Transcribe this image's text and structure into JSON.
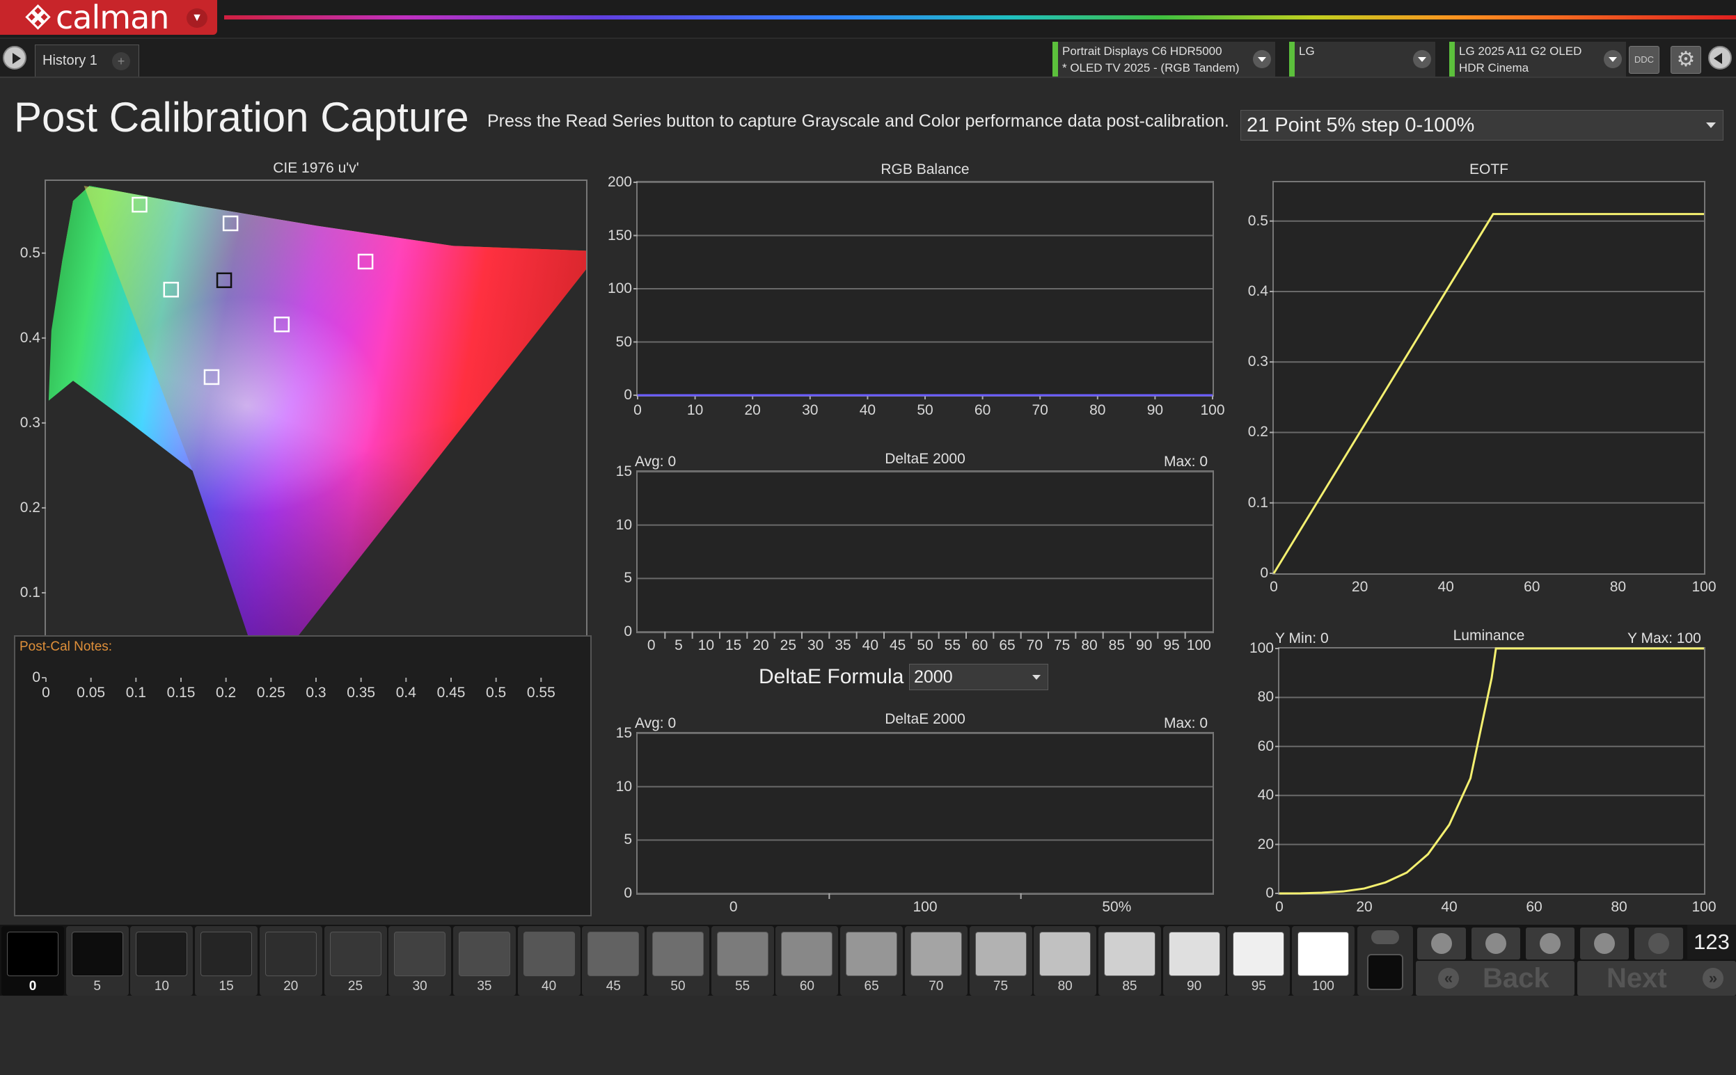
{
  "app": {
    "name": "calman",
    "tab": "History 1",
    "plus": "+"
  },
  "devices": [
    {
      "line1": "Portrait Displays C6 HDR5000",
      "line2": "* OLED TV 2025 - (RGB Tandem)",
      "status_color": "#5cc03c"
    },
    {
      "line1": "LG",
      "line2": "",
      "status_color": "#5cc03c"
    },
    {
      "line1": "LG 2025 A11 G2 OLED",
      "line2": "HDR Cinema",
      "status_color": "#5cc03c"
    }
  ],
  "toolbar": {
    "ddc": "DDC",
    "settings_icon": "gear-icon",
    "collapse_icon": "chevron-left-icon"
  },
  "page": {
    "title": "Post Calibration Capture",
    "instructions": "Press the Read Series button to capture Grayscale and Color performance data post-calibration.",
    "series_select": "21 Point 5% step 0-100%"
  },
  "notes": {
    "label": "Post-Cal Notes:",
    "text": ""
  },
  "formula": {
    "label": "DeltaE Formula",
    "value": "2000"
  },
  "charts": {
    "cie": {
      "title": "CIE 1976 u'v'",
      "yticks": [
        "0.5",
        "0.4",
        "0.3",
        "0.2",
        "0.1",
        "0"
      ],
      "xticks": [
        "0",
        "0.05",
        "0.1",
        "0.15",
        "0.2",
        "0.25",
        "0.3",
        "0.35",
        "0.4",
        "0.45",
        "0.5",
        "0.55"
      ]
    },
    "rgb": {
      "title": "RGB Balance",
      "yticks": [
        "200",
        "150",
        "100",
        "50",
        "0"
      ],
      "xticks": [
        "0",
        "10",
        "20",
        "30",
        "40",
        "50",
        "60",
        "70",
        "80",
        "90",
        "100"
      ]
    },
    "de1": {
      "title": "DeltaE 2000",
      "avg": "Avg: 0",
      "max": "Max: 0",
      "yticks": [
        "15",
        "10",
        "5",
        "0"
      ],
      "xticks": [
        "0",
        "5",
        "10",
        "15",
        "20",
        "25",
        "30",
        "35",
        "40",
        "45",
        "50",
        "55",
        "60",
        "65",
        "70",
        "75",
        "80",
        "85",
        "90",
        "95",
        "100"
      ]
    },
    "de2": {
      "title": "DeltaE 2000",
      "avg": "Avg: 0",
      "max": "Max: 0",
      "yticks": [
        "15",
        "10",
        "5",
        "0"
      ],
      "xticks": [
        "0",
        "100",
        "50%"
      ]
    },
    "eotf": {
      "title": "EOTF",
      "yticks": [
        "0.5",
        "0.4",
        "0.3",
        "0.2",
        "0.1",
        "0"
      ],
      "xticks": [
        "0",
        "20",
        "40",
        "60",
        "80",
        "100"
      ]
    },
    "lum": {
      "title": "Luminance",
      "ymin": "Y Min: 0",
      "ymax": "Y Max: 100",
      "yticks": [
        "100",
        "80",
        "60",
        "40",
        "20",
        "0"
      ],
      "xticks": [
        "0",
        "20",
        "40",
        "60",
        "80",
        "100"
      ]
    }
  },
  "chart_data": [
    {
      "type": "scatter",
      "title": "CIE 1976 u'v'",
      "xlim": [
        0,
        0.6
      ],
      "ylim": [
        0,
        0.6
      ],
      "targets": [
        {
          "u": 0.104,
          "v": 0.557
        },
        {
          "u": 0.205,
          "v": 0.535
        },
        {
          "u": 0.139,
          "v": 0.457
        },
        {
          "u": 0.198,
          "v": 0.468
        },
        {
          "u": 0.355,
          "v": 0.49
        },
        {
          "u": 0.262,
          "v": 0.416
        },
        {
          "u": 0.184,
          "v": 0.354
        }
      ],
      "white_point": {
        "u": 0.198,
        "v": 0.468
      }
    },
    {
      "type": "line",
      "title": "RGB Balance",
      "xlim": [
        0,
        100
      ],
      "ylim": [
        0,
        200
      ],
      "series": [
        {
          "values": [
            0,
            0,
            0,
            0,
            0,
            0,
            0,
            0,
            0,
            0,
            0
          ]
        }
      ],
      "x": [
        0,
        10,
        20,
        30,
        40,
        50,
        60,
        70,
        80,
        90,
        100
      ]
    },
    {
      "type": "line",
      "title": "EOTF",
      "xlim": [
        0,
        100
      ],
      "ylim": [
        0,
        0.55
      ],
      "x": [
        0,
        5,
        10,
        15,
        20,
        25,
        30,
        35,
        40,
        45,
        50,
        51,
        55,
        60,
        65,
        70,
        75,
        80,
        85,
        90,
        95,
        100
      ],
      "series": [
        {
          "values": [
            0,
            0.05,
            0.1,
            0.15,
            0.2,
            0.25,
            0.3,
            0.35,
            0.4,
            0.45,
            0.5,
            0.51,
            0.51,
            0.51,
            0.51,
            0.51,
            0.51,
            0.51,
            0.51,
            0.51,
            0.51,
            0.51
          ]
        }
      ]
    },
    {
      "type": "line",
      "title": "Luminance",
      "xlim": [
        0,
        100
      ],
      "ylim": [
        0,
        100
      ],
      "x": [
        0,
        5,
        10,
        15,
        20,
        25,
        30,
        35,
        40,
        45,
        50,
        51,
        55,
        60,
        65,
        70,
        75,
        80,
        85,
        90,
        95,
        100
      ],
      "series": [
        {
          "values": [
            0,
            0.05,
            0.3,
            0.8,
            2,
            4.5,
            8.5,
            16,
            28,
            47,
            88,
            100,
            100,
            100,
            100,
            100,
            100,
            100,
            100,
            100,
            100,
            100
          ]
        }
      ]
    }
  ],
  "swatches": [
    {
      "label": "0",
      "gray": "#000000"
    },
    {
      "label": "5",
      "gray": "#0d0d0d"
    },
    {
      "label": "10",
      "gray": "#1c1c1c"
    },
    {
      "label": "15",
      "gray": "#252525"
    },
    {
      "label": "20",
      "gray": "#2e2e2e"
    },
    {
      "label": "25",
      "gray": "#373737"
    },
    {
      "label": "30",
      "gray": "#414141"
    },
    {
      "label": "35",
      "gray": "#4b4b4b"
    },
    {
      "label": "40",
      "gray": "#565656"
    },
    {
      "label": "45",
      "gray": "#626262"
    },
    {
      "label": "50",
      "gray": "#6e6e6e"
    },
    {
      "label": "55",
      "gray": "#7b7b7b"
    },
    {
      "label": "60",
      "gray": "#888888"
    },
    {
      "label": "65",
      "gray": "#969696"
    },
    {
      "label": "70",
      "gray": "#a4a4a4"
    },
    {
      "label": "75",
      "gray": "#b2b2b2"
    },
    {
      "label": "80",
      "gray": "#c1c1c1"
    },
    {
      "label": "85",
      "gray": "#d0d0d0"
    },
    {
      "label": "90",
      "gray": "#dfdfdf"
    },
    {
      "label": "95",
      "gray": "#efefef"
    },
    {
      "label": "100",
      "gray": "#ffffff"
    }
  ],
  "controls": {
    "count": "123",
    "back": "Back",
    "next": "Next"
  }
}
